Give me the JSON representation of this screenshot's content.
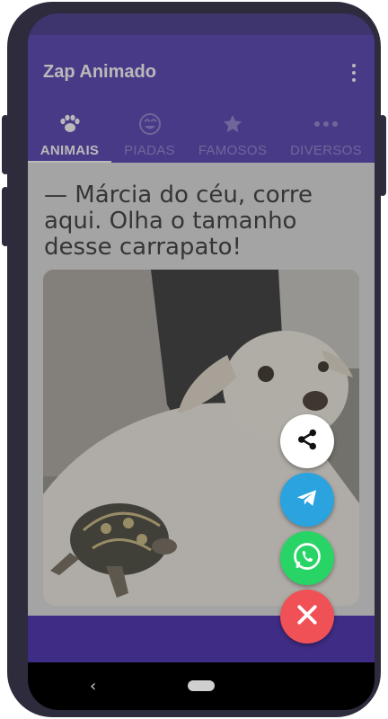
{
  "app": {
    "title": "Zap Animado"
  },
  "tabs": [
    {
      "label": "ANIMAIS",
      "icon": "paw-icon",
      "active": true
    },
    {
      "label": "PIADAS",
      "icon": "laugh-icon",
      "active": false
    },
    {
      "label": "FAMOSOS",
      "icon": "star-icon",
      "active": false
    },
    {
      "label": "DIVERSOS",
      "icon": "more-horiz-icon",
      "active": false
    }
  ],
  "post": {
    "caption": "— Márcia do céu, corre aqui. Olha o tamanho desse carrapato!"
  },
  "fab_actions": [
    {
      "name": "share-icon",
      "color": "#ffffff"
    },
    {
      "name": "telegram-icon",
      "color": "#2aa3df"
    },
    {
      "name": "whatsapp-icon",
      "color": "#29d466"
    },
    {
      "name": "close-icon",
      "color": "#ef5156"
    }
  ],
  "colors": {
    "primary": "#4b32b0",
    "primary_dark": "#3b2a86",
    "tab_inactive": "#8a7acb"
  }
}
